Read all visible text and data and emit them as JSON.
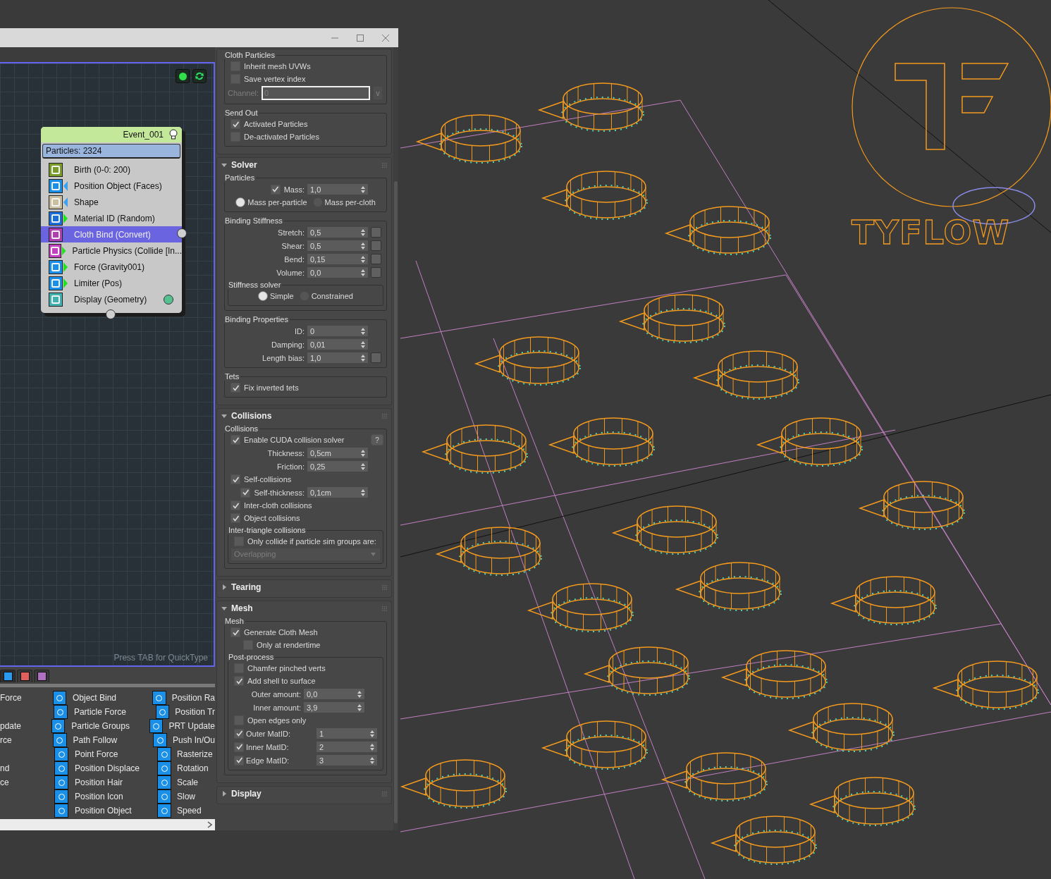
{
  "node_editor": {
    "event": {
      "title": "Event_001",
      "particles": "Particles: 2324",
      "operators": [
        {
          "label": "Birth (0-0: 200)",
          "color": "#7a9a2a",
          "input_marker": false,
          "output_marker": false,
          "status_dot": false,
          "selected": false
        },
        {
          "label": "Position Object (Faces)",
          "color": "#1a8fe8",
          "input_marker": true,
          "output_marker": false,
          "status_dot": false,
          "selected": false
        },
        {
          "label": "Shape",
          "color": "#c8c0a0",
          "input_marker": true,
          "output_marker": false,
          "status_dot": false,
          "selected": false
        },
        {
          "label": "Material ID (Random)",
          "color": "#1a6fd8",
          "input_marker": false,
          "output_marker": true,
          "status_dot": false,
          "selected": false
        },
        {
          "label": "Cloth Bind (Convert)",
          "color": "#b040b0",
          "input_marker": false,
          "output_marker": false,
          "status_dot": false,
          "selected": true
        },
        {
          "label": "Particle Physics (Collide [In...",
          "color": "#c040c0",
          "input_marker": false,
          "output_marker": true,
          "status_dot": false,
          "selected": false
        },
        {
          "label": "Force (Gravity001)",
          "color": "#1a8fe8",
          "input_marker": false,
          "output_marker": true,
          "status_dot": false,
          "selected": false
        },
        {
          "label": "Limiter (Pos)",
          "color": "#1a8fe8",
          "input_marker": false,
          "output_marker": true,
          "status_dot": false,
          "selected": false
        },
        {
          "label": "Display (Geometry)",
          "color": "#40b0b0",
          "input_marker": false,
          "output_marker": false,
          "status_dot": true,
          "selected": false
        }
      ]
    },
    "hint": "Press TAB for QuickType"
  },
  "operator_tabs": [
    {
      "color": "#2a9af0",
      "selected": true
    },
    {
      "color": "#e06060",
      "selected": false
    },
    {
      "color": "#b070c0",
      "selected": false
    }
  ],
  "operator_list": {
    "rows": [
      {
        "column_1": "Force",
        "column_2": "Object Bind",
        "column_3": "Position Ra"
      },
      {
        "column_2": "Particle Force",
        "column_3": "Position Tr"
      },
      {
        "column_1": "pdate",
        "column_2": "Particle Groups",
        "column_3": "PRT Update"
      },
      {
        "column_1": "rce",
        "column_2": "Path Follow",
        "column_3": "Push In/Ou"
      },
      {
        "column_2": "Point Force",
        "column_3": "Rasterize"
      },
      {
        "column_1": "nd",
        "column_2": "Position Displace",
        "column_3": "Rotation"
      },
      {
        "column_1": "ce",
        "column_2": "Position Hair",
        "column_3": "Scale"
      },
      {
        "column_2": "Position Icon",
        "column_3": "Slow"
      },
      {
        "column_2": "Position Object",
        "column_3": "Speed"
      }
    ]
  },
  "parameters": {
    "rollouts": [
      {
        "groups": [
          {
            "title": "Cloth Particles",
            "rows": [
              {
                "kind": "checkbox",
                "label": "Inherit mesh UVWs",
                "checked": false
              },
              {
                "kind": "checkbox",
                "label": "Save vertex index",
                "checked": false
              },
              {
                "kind": "channel",
                "label": "Channel:",
                "value": "0",
                "button": "v",
                "disabled": true
              }
            ]
          },
          {
            "title": "Send Out",
            "rows": [
              {
                "kind": "checkbox",
                "label": "Activated Particles",
                "checked": true
              },
              {
                "kind": "checkbox",
                "label": "De-activated Particles",
                "checked": false
              }
            ]
          }
        ]
      },
      {
        "title": "Solver",
        "expanded": true,
        "groups": [
          {
            "title": "Particles",
            "rows": [
              {
                "kind": "spinner",
                "label": "Mass:",
                "value": "1,0",
                "checked": true
              },
              {
                "kind": "radio",
                "options": [
                  {
                    "label": "Mass per-particle",
                    "selected": true
                  },
                  {
                    "label": "Mass per-cloth",
                    "selected": false
                  }
                ]
              }
            ]
          },
          {
            "title": "Binding Stiffness",
            "rows": [
              {
                "kind": "spinner",
                "label": "Stretch:",
                "value": "0,5",
                "map_button": true
              },
              {
                "kind": "spinner",
                "label": "Shear:",
                "value": "0,5",
                "map_button": true
              },
              {
                "kind": "spinner",
                "label": "Bend:",
                "value": "0,15",
                "map_button": true
              },
              {
                "kind": "spinner",
                "label": "Volume:",
                "value": "0,0",
                "map_button": true
              },
              {
                "kind": "group",
                "title": "Stiffness solver",
                "rows": [
                  {
                    "kind": "radio",
                    "options": [
                      {
                        "label": "Simple",
                        "selected": true
                      },
                      {
                        "label": "Constrained",
                        "selected": false
                      }
                    ]
                  }
                ]
              }
            ]
          },
          {
            "title": "Binding Properties",
            "rows": [
              {
                "kind": "spinner",
                "label": "ID:",
                "value": "0"
              },
              {
                "kind": "spinner",
                "label": "Damping:",
                "value": "0,01"
              },
              {
                "kind": "spinner",
                "label": "Length bias:",
                "value": "1,0",
                "map_button": true
              }
            ]
          },
          {
            "title": "Tets",
            "rows": [
              {
                "kind": "checkbox",
                "label": "Fix inverted tets",
                "checked": true
              }
            ]
          }
        ]
      },
      {
        "title": "Collisions",
        "expanded": true,
        "groups": [
          {
            "title": "Collisions",
            "rows": [
              {
                "kind": "checkbox",
                "label": "Enable CUDA collision solver",
                "checked": true,
                "help": "?"
              },
              {
                "kind": "spinner",
                "label": "Thickness:",
                "value": "0,5cm"
              },
              {
                "kind": "spinner",
                "label": "Friction:",
                "value": "0,25"
              },
              {
                "kind": "checkbox",
                "label": "Self-collisions",
                "checked": true,
                "children": [
                  {
                    "kind": "spinner",
                    "label": "Self-thickness:",
                    "value": "0,1cm",
                    "checked": true
                  }
                ]
              },
              {
                "kind": "checkbox",
                "label": "Inter-cloth collisions",
                "checked": true
              },
              {
                "kind": "checkbox",
                "label": "Object collisions",
                "checked": true
              },
              {
                "kind": "group",
                "title": "Inter-triangle collisions",
                "rows": [
                  {
                    "kind": "checkbox",
                    "label": "Only collide if particle sim groups are:",
                    "checked": false
                  },
                  {
                    "kind": "dropdown",
                    "value": "Overlapping",
                    "disabled": true
                  }
                ]
              }
            ]
          }
        ]
      },
      {
        "title": "Tearing",
        "expanded": false
      },
      {
        "title": "Mesh",
        "expanded": true,
        "groups": [
          {
            "title": "Mesh",
            "rows": [
              {
                "kind": "checkbox",
                "label": "Generate Cloth Mesh",
                "checked": true,
                "children": [
                  {
                    "kind": "checkbox",
                    "label": "Only at rendertime",
                    "checked": false
                  }
                ]
              },
              {
                "kind": "group",
                "title": "Post-process",
                "rows": [
                  {
                    "kind": "checkbox",
                    "label": "Chamfer pinched verts",
                    "checked": false
                  },
                  {
                    "kind": "checkbox",
                    "label": "Add shell to surface",
                    "checked": true
                  },
                  {
                    "kind": "spinner",
                    "label": "Outer amount:",
                    "value": "0,0"
                  },
                  {
                    "kind": "spinner",
                    "label": "Inner amount:",
                    "value": "3,9"
                  },
                  {
                    "kind": "checkbox",
                    "label": "Open edges only",
                    "checked": false
                  },
                  {
                    "kind": "check-spinner",
                    "label": "Outer MatID:",
                    "value": "1",
                    "checked": true
                  },
                  {
                    "kind": "check-spinner",
                    "label": "Inner MatID:",
                    "value": "2",
                    "checked": true
                  },
                  {
                    "kind": "check-spinner",
                    "label": "Edge MatID:",
                    "value": "3",
                    "checked": true
                  }
                ]
              }
            ]
          }
        ]
      },
      {
        "title": "Display",
        "expanded": false
      }
    ]
  },
  "viewport": {
    "logo": "TYFLOW"
  }
}
